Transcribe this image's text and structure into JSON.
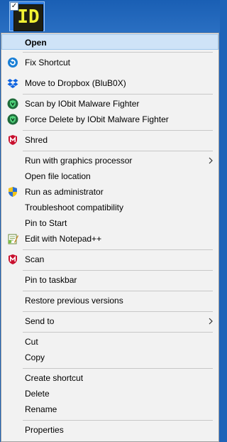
{
  "file_icon": {
    "glyph": "ID",
    "checkbox": "✓"
  },
  "menu": {
    "open": "Open",
    "fix_shortcut": "Fix Shortcut",
    "move_to_dropbox": "Move to Dropbox (BluB0X)",
    "scan_iobit": "Scan by IObit Malware Fighter",
    "force_delete_iobit": "Force Delete by IObit Malware Fighter",
    "shred": "Shred",
    "run_gpu": "Run with graphics processor",
    "open_file_location": "Open file location",
    "run_as_admin": "Run as administrator",
    "troubleshoot": "Troubleshoot compatibility",
    "pin_start": "Pin to Start",
    "edit_notepad": "Edit with Notepad++",
    "scan": "Scan",
    "pin_taskbar": "Pin to taskbar",
    "restore_versions": "Restore previous versions",
    "send_to": "Send to",
    "cut": "Cut",
    "copy": "Copy",
    "create_shortcut": "Create shortcut",
    "delete": "Delete",
    "rename": "Rename",
    "properties": "Properties"
  }
}
